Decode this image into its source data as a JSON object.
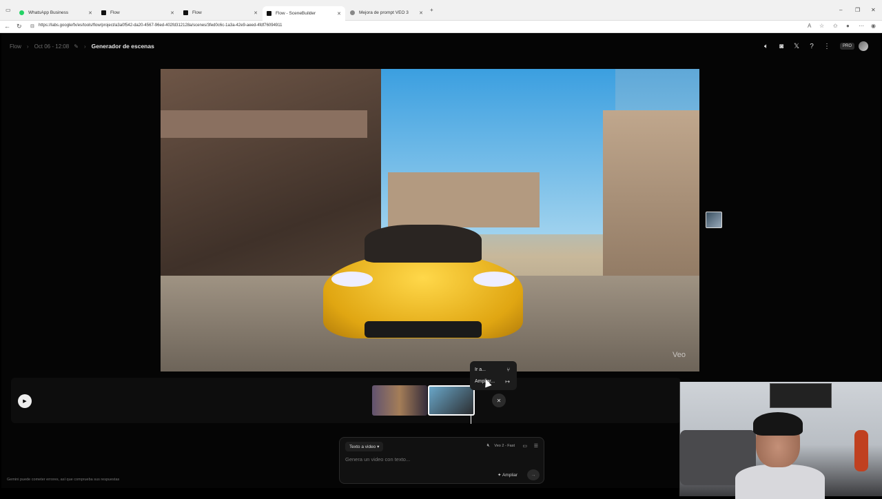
{
  "browser": {
    "tabs": [
      {
        "label": "WhatsApp Business",
        "favicon_color": "#25d366"
      },
      {
        "label": "Flow",
        "favicon_color": "#111111"
      },
      {
        "label": "Flow",
        "favicon_color": "#111111"
      },
      {
        "label": "Flow - SceneBuilder",
        "favicon_color": "#111111"
      },
      {
        "label": "Mejora de prompt VEO 3",
        "favicon_color": "#666666"
      }
    ],
    "url": "https://labs.google/fx/es/tools/flow/project/a3a0f542-da20-4567-96ed-402fd312128a/scenes/3fed0c6c-1a3a-42e9-aeed-4fdf76094911"
  },
  "header": {
    "breadcrumb_root": "Flow",
    "breadcrumb_date": "Oct 06 - 12:08",
    "title": "Generador de escenas",
    "pro_badge": "PRO"
  },
  "video": {
    "watermark": "Veo"
  },
  "context_menu": {
    "items": [
      {
        "label": "Ir a...",
        "icon": "branch-icon"
      },
      {
        "label": "Ampliar...",
        "icon": "extend-icon"
      }
    ]
  },
  "prompt": {
    "mode": "Texto a video",
    "model": "Veo 2 - Fast",
    "placeholder": "Genera un video con texto...",
    "amplify_label": "Ampliar"
  },
  "disclaimer": "Gemini puede cometer errores, así que comprueba sus respuestas"
}
